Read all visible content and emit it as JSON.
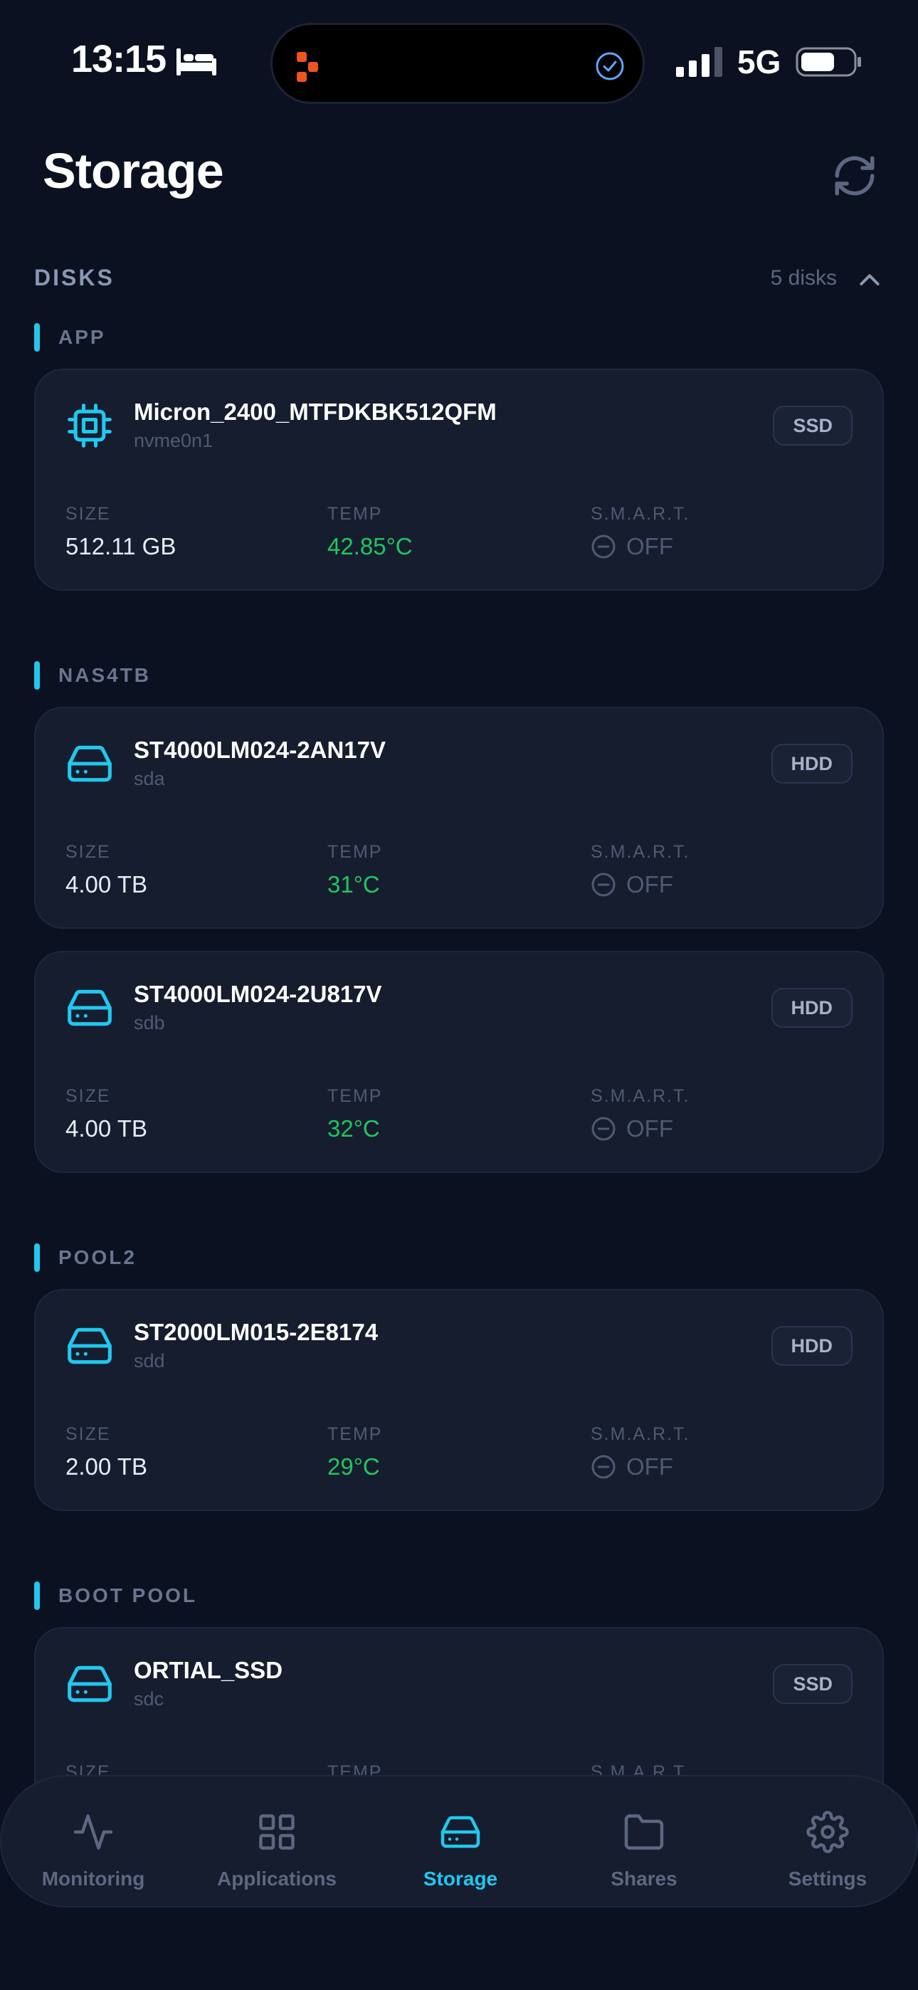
{
  "status_bar": {
    "time": "13:15",
    "network": "5G"
  },
  "header": {
    "title": "Storage"
  },
  "disks": {
    "label": "DISKS",
    "count": "5 disks"
  },
  "groups": [
    {
      "label": "APP",
      "disks": [
        {
          "name": "Micron_2400_MTFDKBK512QFM",
          "device": "nvme0n1",
          "type": "SSD",
          "icon": "chip-icon",
          "size_label": "SIZE",
          "size": "512.11 GB",
          "temp_label": "TEMP",
          "temp": "42.85°C",
          "smart_label": "S.M.A.R.T.",
          "smart": "OFF"
        }
      ]
    },
    {
      "label": "NAS4TB",
      "disks": [
        {
          "name": "ST4000LM024-2AN17V",
          "device": "sda",
          "type": "HDD",
          "icon": "hard-drive-icon",
          "size_label": "SIZE",
          "size": "4.00 TB",
          "temp_label": "TEMP",
          "temp": "31°C",
          "smart_label": "S.M.A.R.T.",
          "smart": "OFF"
        },
        {
          "name": "ST4000LM024-2U817V",
          "device": "sdb",
          "type": "HDD",
          "icon": "hard-drive-icon",
          "size_label": "SIZE",
          "size": "4.00 TB",
          "temp_label": "TEMP",
          "temp": "32°C",
          "smart_label": "S.M.A.R.T.",
          "smart": "OFF"
        }
      ]
    },
    {
      "label": "POOL2",
      "disks": [
        {
          "name": "ST2000LM015-2E8174",
          "device": "sdd",
          "type": "HDD",
          "icon": "hard-drive-icon",
          "size_label": "SIZE",
          "size": "2.00 TB",
          "temp_label": "TEMP",
          "temp": "29°C",
          "smart_label": "S.M.A.R.T.",
          "smart": "OFF"
        }
      ]
    },
    {
      "label": "BOOT POOL",
      "disks": [
        {
          "name": "ORTIAL_SSD",
          "device": "sdc",
          "type": "SSD",
          "icon": "hard-drive-icon",
          "size_label": "SIZE",
          "temp_label": "TEMP",
          "smart_label": "S.M.A.R.T."
        }
      ]
    }
  ],
  "tabs": [
    {
      "label": "Monitoring",
      "icon": "activity-icon",
      "active": false
    },
    {
      "label": "Applications",
      "icon": "grid-icon",
      "active": false
    },
    {
      "label": "Storage",
      "icon": "hard-drive-icon",
      "active": true
    },
    {
      "label": "Shares",
      "icon": "folder-icon",
      "active": false
    },
    {
      "label": "Settings",
      "icon": "gear-icon",
      "active": false
    }
  ],
  "colors": {
    "accent": "#22c7ee",
    "temp_ok": "#22c55e",
    "background": "#0b1120",
    "card": "#151d2f"
  }
}
